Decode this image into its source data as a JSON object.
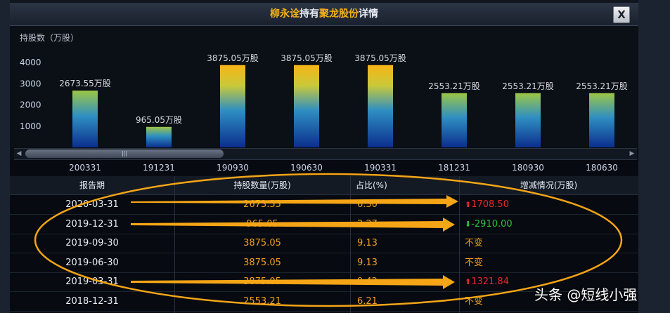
{
  "window": {
    "title_name": "柳永诠",
    "title_mid": "持有",
    "title_stock": "聚龙股份",
    "title_end": "详情",
    "close_label": "X"
  },
  "chart_data": {
    "type": "bar",
    "title": "",
    "ylabel": "持股数（万股）",
    "categories": [
      "200331",
      "191231",
      "190930",
      "190630",
      "190331",
      "181231",
      "180930",
      "180630"
    ],
    "values": [
      2673.55,
      965.05,
      3875.05,
      3875.05,
      3875.05,
      2553.21,
      2553.21,
      2553.21
    ],
    "data_labels": [
      "2673.55万股",
      "965.05万股",
      "3875.05万股",
      "3875.05万股",
      "3875.05万股",
      "2553.21万股",
      "2553.21万股",
      "2553.21万股"
    ],
    "yticks": [
      "1000",
      "2000",
      "3000",
      "4000"
    ],
    "ylim": [
      0,
      4250
    ],
    "grid": false,
    "legend": "none"
  },
  "scrollbar": {
    "left_arrow": "◀",
    "right_arrow": "▶",
    "grip": "|||"
  },
  "table": {
    "headers": [
      "报告期",
      "持股数量(万股)",
      "占比(%)",
      "增减情况(万股)"
    ],
    "rows": [
      {
        "date": "2020-03-31",
        "amount": "2673.55",
        "pct": "6.30",
        "change": "1708.50",
        "dir": "up",
        "arrow": "🡅"
      },
      {
        "date": "2019-12-31",
        "amount": "965.05",
        "pct": "2.27",
        "change": "-2910.00",
        "dir": "down",
        "arrow": "🡇"
      },
      {
        "date": "2019-09-30",
        "amount": "3875.05",
        "pct": "9.13",
        "change": "不变",
        "dir": "flat",
        "arrow": ""
      },
      {
        "date": "2019-06-30",
        "amount": "3875.05",
        "pct": "9.13",
        "change": "不变",
        "dir": "flat",
        "arrow": ""
      },
      {
        "date": "2019-03-31",
        "amount": "3875.05",
        "pct": "9.42",
        "change": "1321.84",
        "dir": "up",
        "arrow": "🡅"
      },
      {
        "date": "2018-12-31",
        "amount": "2553.21",
        "pct": "6.21",
        "change": "不变",
        "dir": "flat",
        "arrow": ""
      }
    ]
  },
  "colors": {
    "accent": "#f5b21a",
    "annotation": "#f5a516",
    "up": "#e8262c",
    "down": "#2ec340"
  },
  "watermark": "头条 @短线小强"
}
